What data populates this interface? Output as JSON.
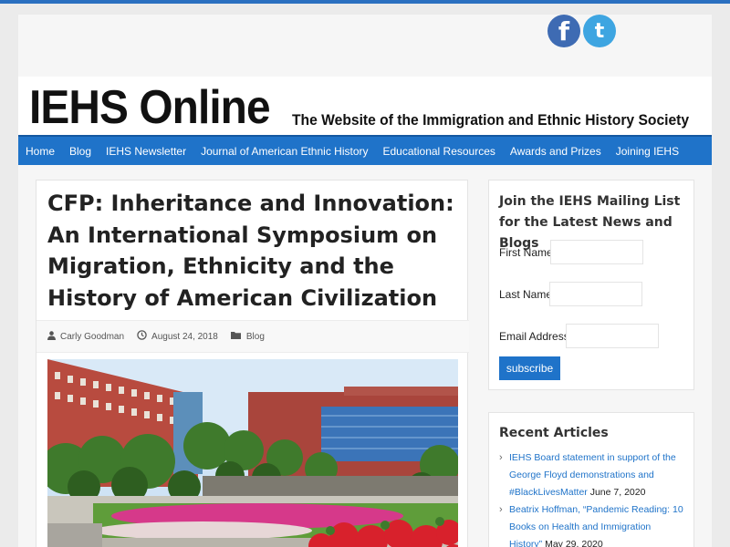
{
  "social": {
    "facebook_glyph": "f",
    "twitter_glyph": "t"
  },
  "site": {
    "logo": "IEHS Online",
    "tagline": "The Website of the Immigration and Ethnic History Society"
  },
  "nav": [
    "Home",
    "Blog",
    "IEHS Newsletter",
    "Journal of American Ethnic History",
    "Educational Resources",
    "Awards and Prizes",
    "Joining IEHS"
  ],
  "post": {
    "title": "CFP: Inheritance and Innovation: An International Symposium on Migration, Ethnicity and the History of American Civilization",
    "author": "Carly Goodman",
    "date": "August 24, 2018",
    "category": "Blog"
  },
  "mailing": {
    "title": "Join the IEHS Mailing List for the Latest News and Blogs",
    "first_name_label": "First Name",
    "last_name_label": "Last Name",
    "email_label": "Email Address",
    "subscribe_label": "subscribe"
  },
  "recent": {
    "title": "Recent Articles",
    "items": [
      {
        "link": "IEHS Board statement in support of the George Floyd demonstrations and #BlackLivesMatter",
        "date": "June 7, 2020"
      },
      {
        "link": "Beatrix Hoffman, “Pandemic Reading: 10 Books on Health and Immigration History”",
        "date": "May 29, 2020"
      }
    ]
  },
  "colors": {
    "nav_bg": "#1f73c9",
    "link": "#1f73c9",
    "facebook": "#3e6bb3",
    "twitter": "#3ea5e1"
  }
}
